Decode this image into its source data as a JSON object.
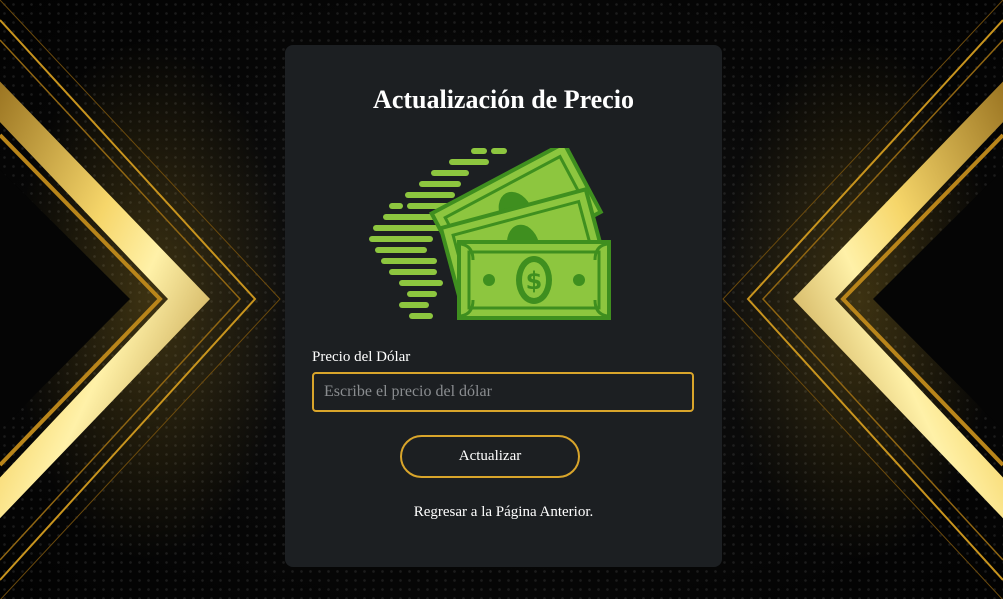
{
  "form": {
    "title": "Actualización de Precio",
    "price_label": "Precio del Dólar",
    "price_value": "",
    "price_placeholder": "Escribe el precio del dólar",
    "submit_label": "Actualizar",
    "back_link": "Regresar a la Página Anterior."
  },
  "illustration": {
    "name": "money-bills-icon",
    "currency_symbol": "$"
  },
  "colors": {
    "background": "#050505",
    "card": "#1c1f22",
    "accent_gold": "#d9a52b",
    "money_green": "#8dc63f",
    "money_dark_green": "#3f8f1f",
    "text": "#ffffff",
    "placeholder": "#8a8d90"
  }
}
